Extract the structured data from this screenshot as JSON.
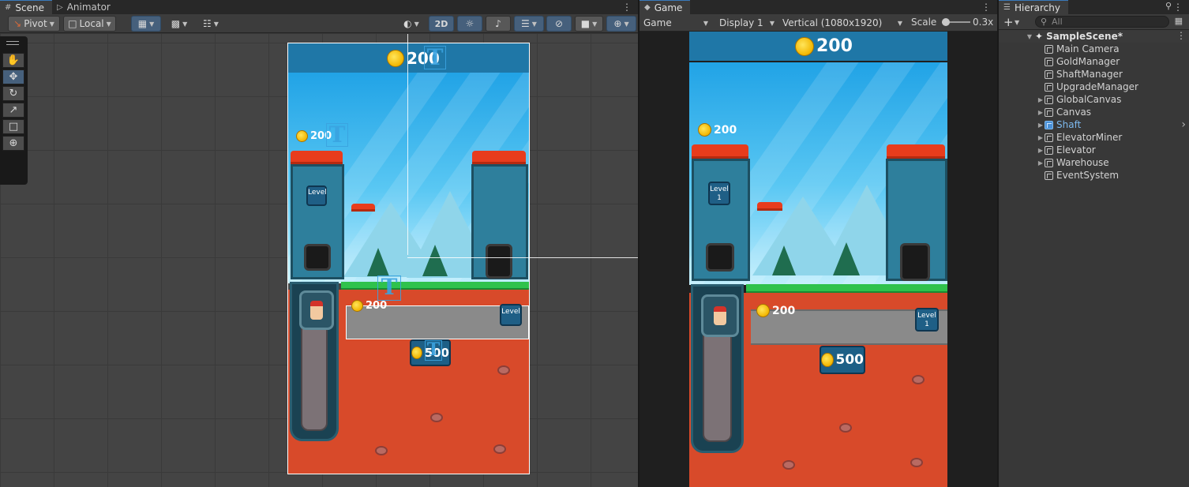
{
  "scene": {
    "tabs": [
      {
        "label": "Scene"
      },
      {
        "label": "Animator"
      }
    ],
    "toolbar": {
      "pivot_label": "Pivot",
      "local_label": "Local",
      "mode_2d_label": "2D"
    },
    "tools": [
      "hand",
      "move",
      "rotate",
      "scale",
      "rect",
      "transform"
    ]
  },
  "game_art": {
    "top_gold": "200",
    "shaft_gold": "200",
    "tunnel_gold": "200",
    "level_label": "Level",
    "level_number": "1",
    "upgrade_cost": "500"
  },
  "game": {
    "tab_label": "Game",
    "mode_select": "Game",
    "display_select": "Display 1",
    "resolution_select": "Vertical (1080x1920)",
    "scale_label": "Scale",
    "scale_value": "0.3x"
  },
  "hierarchy": {
    "tab_label": "Hierarchy",
    "search_placeholder": "All",
    "scene_name": "SampleScene*",
    "items": [
      {
        "label": "Main Camera",
        "expandable": false,
        "selected": false
      },
      {
        "label": "GoldManager",
        "expandable": false,
        "selected": false
      },
      {
        "label": "ShaftManager",
        "expandable": false,
        "selected": false
      },
      {
        "label": "UpgradeManager",
        "expandable": false,
        "selected": false
      },
      {
        "label": "GlobalCanvas",
        "expandable": true,
        "selected": false
      },
      {
        "label": "Canvas",
        "expandable": true,
        "selected": false
      },
      {
        "label": "Shaft",
        "expandable": true,
        "selected": true
      },
      {
        "label": "ElevatorMiner",
        "expandable": true,
        "selected": false
      },
      {
        "label": "Elevator",
        "expandable": true,
        "selected": false
      },
      {
        "label": "Warehouse",
        "expandable": true,
        "selected": false
      },
      {
        "label": "EventSystem",
        "expandable": false,
        "selected": false
      }
    ]
  },
  "colors": {
    "accent": "#46607c",
    "selected_text": "#7db9ee"
  }
}
